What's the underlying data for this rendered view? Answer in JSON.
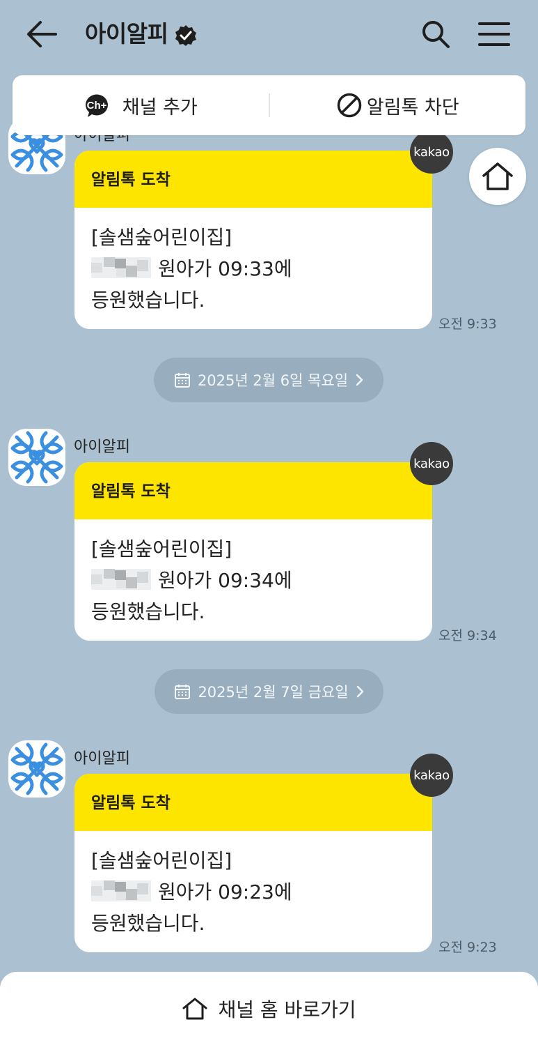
{
  "header": {
    "title": "아이알피",
    "icons": [
      "back-arrow-icon",
      "verified-badge-icon",
      "search-icon",
      "menu-icon"
    ]
  },
  "action_bar": {
    "add_channel_label": "채널 추가",
    "add_channel_icon_text": "Ch+",
    "block_label": "알림톡 차단"
  },
  "messages": [
    {
      "sender": "아이알피",
      "head": "알림톡 도착",
      "line1": "[솔샘숲어린이집]",
      "line2": "원아가 09:33에",
      "line3": "등원했습니다.",
      "time": "오전 9:33",
      "badge": "kakao"
    },
    {
      "sender": "아이알피",
      "head": "알림톡 도착",
      "line1": "[솔샘숲어린이집]",
      "line2": "원아가 09:34에",
      "line3": "등원했습니다.",
      "time": "오전 9:34",
      "badge": "kakao"
    },
    {
      "sender": "아이알피",
      "head": "알림톡 도착",
      "line1": "[솔샘숲어린이집]",
      "line2": "원아가 09:23에",
      "line3": "등원했습니다.",
      "time": "오전 9:23",
      "badge": "kakao"
    }
  ],
  "dates": [
    {
      "label": "2025년 2월 6일 목요일"
    },
    {
      "label": "2025년 2월 7일 금요일"
    }
  ],
  "bottom": {
    "label": "채널 홈 바로가기"
  },
  "colors": {
    "background": "#abc1d1",
    "bubble_header": "#fee500",
    "date_pill": "#98aebe",
    "avatar_blue": "#3b8fe0"
  }
}
